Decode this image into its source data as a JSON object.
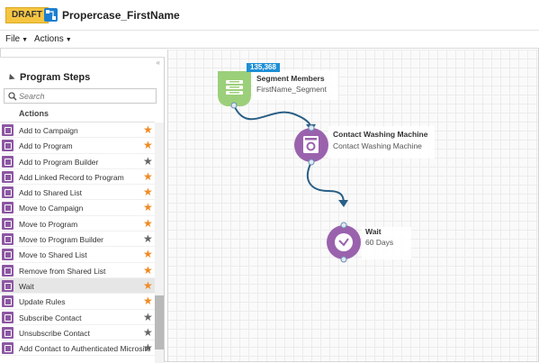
{
  "header": {
    "status_badge": "DRAFT",
    "program_name": "Propercase_FirstName"
  },
  "menubar": {
    "file_label": "File",
    "actions_label": "Actions"
  },
  "panel": {
    "title": "Program Steps",
    "collapse_glyph": "«",
    "search_placeholder": "Search",
    "section_label": "Actions",
    "items": [
      {
        "label": "Add to Campaign",
        "favorite": true
      },
      {
        "label": "Add to Program",
        "favorite": true
      },
      {
        "label": "Add to Program Builder",
        "favorite": false
      },
      {
        "label": "Add Linked Record to Program",
        "favorite": true
      },
      {
        "label": "Add to Shared List",
        "favorite": true
      },
      {
        "label": "Move to Campaign",
        "favorite": true
      },
      {
        "label": "Move to Program",
        "favorite": true
      },
      {
        "label": "Move to Program Builder",
        "favorite": false
      },
      {
        "label": "Move to Shared List",
        "favorite": true
      },
      {
        "label": "Remove from Shared List",
        "favorite": true
      },
      {
        "label": "Wait",
        "favorite": true,
        "selected": true
      },
      {
        "label": "Update Rules",
        "favorite": true
      },
      {
        "label": "Subscribe Contact",
        "favorite": false
      },
      {
        "label": "Unsubscribe Contact",
        "favorite": false
      },
      {
        "label": "Add Contact to Authenticated Microsite",
        "favorite": false
      }
    ]
  },
  "canvas": {
    "nodes": [
      {
        "name": "Segment Members",
        "subtitle": "FirstName_Segment",
        "count": "135,368",
        "color": "#9ccf7a"
      },
      {
        "name": "Contact Washing Machine",
        "subtitle": "Contact Washing Machine",
        "color": "#9a62ad"
      },
      {
        "name": "Wait",
        "subtitle": "60 Days",
        "color": "#9a62ad"
      }
    ]
  },
  "colors": {
    "draft_badge": "#f5c542",
    "accent_blue": "#1e8fd6",
    "connector": "#2a5f86",
    "favorite_star": "#f08a24",
    "step_icon": "#8d58a3"
  },
  "icons": {
    "program": "program-flow-icon",
    "search": "search-icon",
    "segment": "segment-icon",
    "washing": "washing-machine-icon",
    "wait": "clock-icon",
    "star": "star-icon"
  }
}
